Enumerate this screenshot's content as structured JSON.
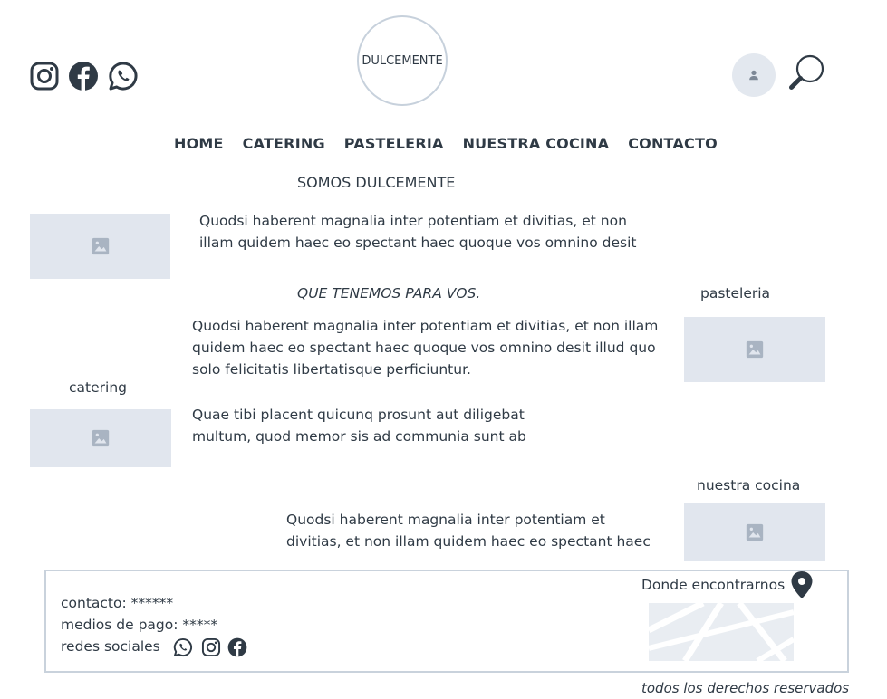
{
  "header": {
    "logo_text": "DULCEMENTE",
    "social_icons": [
      "instagram-icon",
      "facebook-icon",
      "whatsapp-icon"
    ],
    "user_icon": "user-icon",
    "search_icon": "search-icon"
  },
  "nav": {
    "items": [
      "HOME",
      "CATERING",
      "PASTELERIA",
      "NUESTRA COCINA",
      "CONTACTO"
    ]
  },
  "main": {
    "title": "SOMOS DULCEMENTE",
    "intro_text": [
      "Quodsi haberent magnalia inter potentiam et divitias, et non",
      "illam quidem haec eo spectant haec quoque vos omnino desit"
    ],
    "section_title": "QUE TENEMOS PARA VOS.",
    "pasteleria_label": "pasteleria",
    "pasteleria_text": [
      "Quodsi haberent magnalia inter potentiam et divitias, et non illam",
      "quidem haec eo spectant haec quoque vos omnino desit illud quo",
      "solo felicitatis libertatisque perficiuntur."
    ],
    "catering_label": "catering",
    "catering_text": [
      "Quae tibi placent quicunq prosunt aut diligebat",
      "multum, quod memor sis ad communia sunt ab"
    ],
    "cocina_label": "nuestra cocina",
    "cocina_text": [
      "Quodsi haberent magnalia inter potentiam et",
      "divitias, et non illam quidem haec eo spectant haec"
    ]
  },
  "footer": {
    "contact": "contacto: ******",
    "payment": "medios de pago: *****",
    "social_label": "redes sociales",
    "location_label": "Donde encontrarnos",
    "rights": "todos los derechos reservados"
  },
  "colors": {
    "text": "#2f3a45",
    "placeholder_bg": "#e1e6ee",
    "placeholder_icon": "#a9b4c2",
    "border": "#c9d2dc"
  }
}
